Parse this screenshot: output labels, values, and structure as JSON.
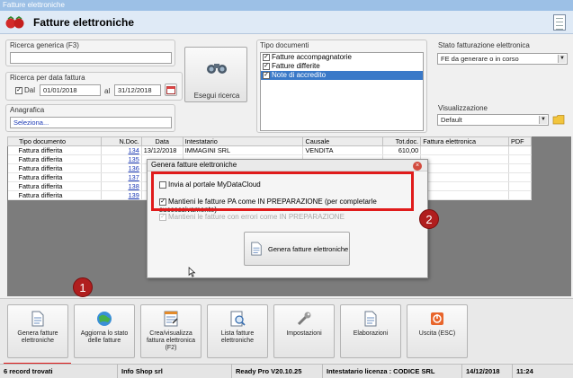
{
  "window": {
    "title": "Fatture elettroniche"
  },
  "header": {
    "title": "Fatture elettroniche"
  },
  "filters": {
    "ricerca_generica": {
      "label": "Ricerca generica (F3)",
      "value": ""
    },
    "ricerca_data": {
      "label": "Ricerca per data fattura",
      "dal_label": "Dal",
      "dal_value": "01/01/2018",
      "al_label": "al",
      "al_value": "31/12/2018"
    },
    "anagrafica": {
      "label": "Anagrafica",
      "value": "Seleziona..."
    },
    "esegui_label": "Esegui ricerca",
    "tipo_documenti": {
      "label": "Tipo documenti",
      "items": [
        {
          "label": "Fatture accompagnatorie",
          "checked": true
        },
        {
          "label": "Fatture differite",
          "checked": true
        },
        {
          "label": "Note di accredito",
          "checked": true
        }
      ]
    },
    "stato": {
      "label": "Stato fatturazione elettronica",
      "value": "FE da generare o in corso"
    },
    "visualizzazione": {
      "label": "Visualizzazione",
      "value": "Default"
    }
  },
  "table": {
    "columns": [
      "Tipo documento",
      "N.Doc.",
      "Data",
      "Intestatario",
      "Causale",
      "Tot.doc.",
      "Fattura elettronica",
      "PDF"
    ],
    "rows": [
      [
        "Fattura differita",
        "134",
        "13/12/2018",
        "IMMAGINI SRL",
        "VENDITA",
        "610,00",
        "",
        ""
      ],
      [
        "Fattura differita",
        "135",
        "",
        "",
        "",
        "",
        "",
        ""
      ],
      [
        "Fattura differita",
        "136",
        "",
        "",
        "",
        "",
        "",
        ""
      ],
      [
        "Fattura differita",
        "137",
        "",
        "",
        "",
        "",
        "",
        ""
      ],
      [
        "Fattura differita",
        "138",
        "",
        "",
        "",
        "",
        "",
        ""
      ],
      [
        "Fattura differita",
        "139",
        "",
        "",
        "",
        "",
        "",
        ""
      ]
    ]
  },
  "dialog": {
    "title": "Genera fatture elettroniche",
    "opt1": "Invia al portale MyDataCloud",
    "opt2": "Mantieni le fatture PA come IN PREPARAZIONE (per completarle successivamente)",
    "opt3": "Mantieni le fatture con errori come IN PREPARAZIONE",
    "button": "Genera fatture elettroniche"
  },
  "callouts": {
    "one": "1",
    "two": "2"
  },
  "toolbar": {
    "genera": "Genera fatture elettroniche",
    "aggiorna": "Aggiorna lo stato delle fatture",
    "crea": "Crea/visualizza fattura elettronica (F2)",
    "lista": "Lista fatture elettroniche",
    "impostazioni": "Impostazioni",
    "elaborazioni": "Elaborazioni",
    "uscita": "Uscita (ESC)"
  },
  "status": {
    "records": "6 record trovati",
    "company": "Info Shop srl",
    "version": "Ready Pro V20.10.25",
    "licenza": "Intestatario licenza : CODICE SRL",
    "date": "14/12/2018",
    "time": "11:24"
  }
}
